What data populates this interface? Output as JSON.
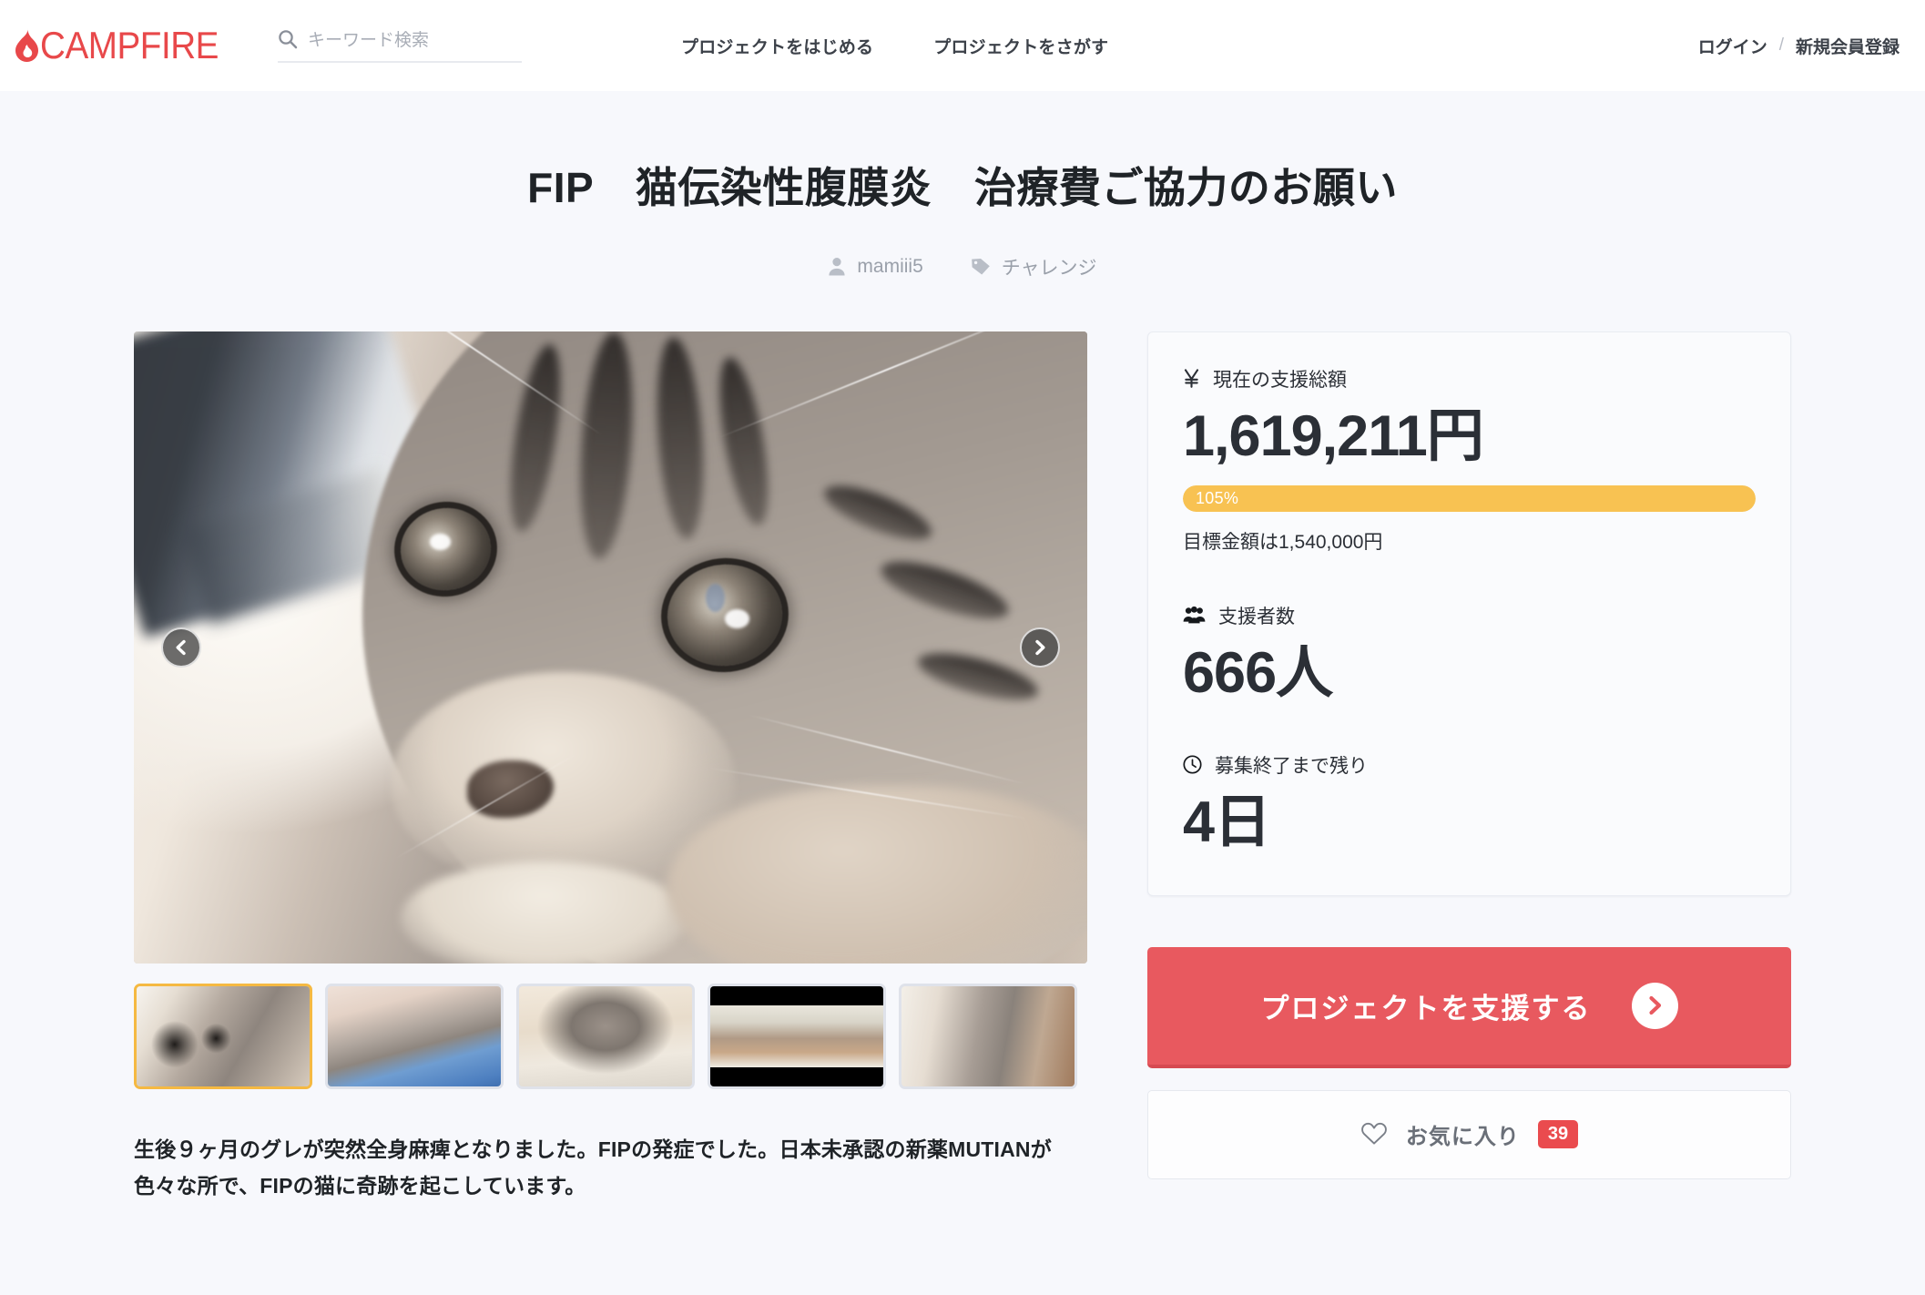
{
  "brand": {
    "name": "CAMPFIRE",
    "color": "#e8484a"
  },
  "header": {
    "search": {
      "placeholder": "キーワード検索",
      "value": ""
    },
    "nav": [
      {
        "label": "プロジェクトをはじめる"
      },
      {
        "label": "プロジェクトをさがす"
      }
    ],
    "account": {
      "login_label": "ログイン",
      "separator": "/",
      "register_label": "新規会員登録"
    }
  },
  "project": {
    "title": "FIP　猫伝染性腹膜炎　治療費ご協力のお願い",
    "owner": "mamiii5",
    "category": "チャレンジ",
    "description": "生後９ヶ月のグレが突然全身麻痺となりました。FIPの発症でした。日本未承認の新薬MUTIANが色々な所で、FIPの猫に奇跡を起こしています。"
  },
  "gallery": {
    "prev_label": "前の画像",
    "next_label": "次の画像",
    "active_index": 0,
    "thumbnails": [
      {
        "alt": "子猫の顔のアップ"
      },
      {
        "alt": "ジーンズの上で伸びる子猫"
      },
      {
        "alt": "ベッドの上に座る子猫"
      },
      {
        "alt": "床で寝そべる２匹の猫"
      },
      {
        "alt": "ソファで寝転ぶ子猫"
      }
    ]
  },
  "stats": {
    "amount": {
      "icon": "yen-icon",
      "label": "現在の支援総額",
      "value": "1,619,211円",
      "percent_label": "105%",
      "percent_value": 105,
      "goal_text": "目標金額は1,540,000円",
      "bar_color": "#f8c252"
    },
    "supporters": {
      "icon": "people-icon",
      "label": "支援者数",
      "value": "666人"
    },
    "remaining": {
      "icon": "clock-icon",
      "label": "募集終了まで残り",
      "value": "4日"
    }
  },
  "actions": {
    "support": {
      "label": "プロジェクトを支援する",
      "color": "#e8595f"
    },
    "favorite": {
      "label": "お気に入り",
      "count": "39",
      "badge_color": "#ea4b4e"
    }
  }
}
